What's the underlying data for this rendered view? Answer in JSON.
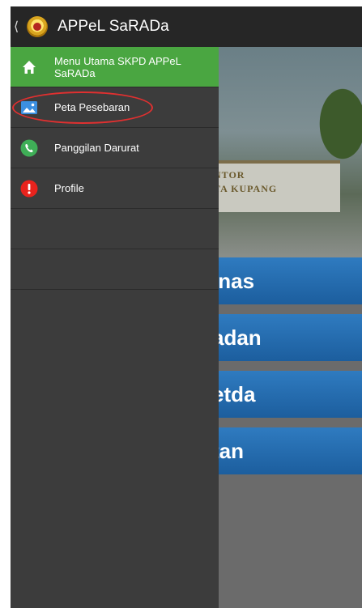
{
  "app": {
    "title": "APPeL SaRADa"
  },
  "drawer": {
    "items": [
      {
        "label": "Menu Utama SKPD APPeL SaRADa",
        "icon": "home-icon",
        "active": true
      },
      {
        "label": "Peta Pesebaran",
        "icon": "image-icon",
        "active": false
      },
      {
        "label": "Panggilan Darurat",
        "icon": "phone-icon",
        "active": false
      },
      {
        "label": "Profile",
        "icon": "alert-icon",
        "active": false
      }
    ]
  },
  "background": {
    "sign_line1": "NTOR",
    "sign_line2": "TA KUPANG",
    "buttons": [
      "inas",
      "adan",
      "etda",
      "tan"
    ]
  },
  "colors": {
    "active": "#4aa641",
    "appbar": "#262626",
    "drawer": "#3c3c3c",
    "button": "#2f7bc0",
    "highlight": "#e03030"
  }
}
